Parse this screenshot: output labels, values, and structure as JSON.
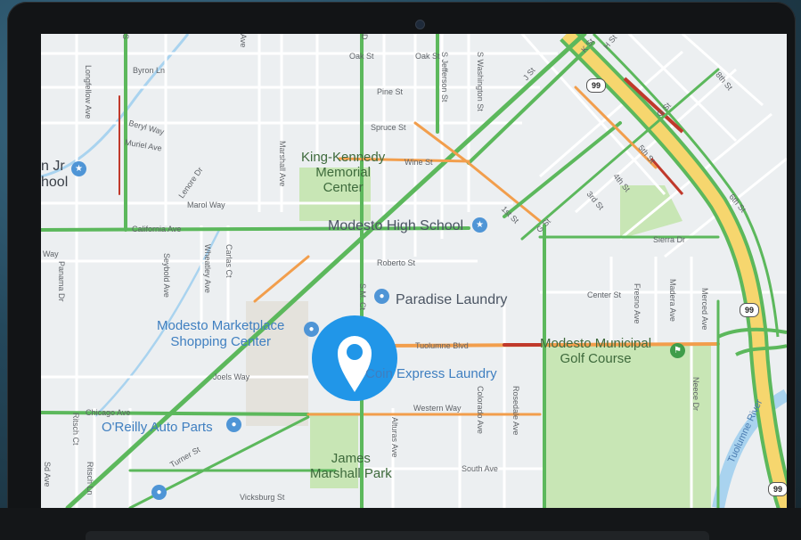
{
  "map": {
    "streets": {
      "oak_st": "Oak St",
      "oak_st2": "Oak St",
      "pine_st": "Pine St",
      "spruce_st": "Spruce St",
      "wine_st": "Wine St",
      "roberto_st": "Roberto St",
      "center_st": "Center St",
      "tuolumne_blvd": "Tuolumne Blvd",
      "western_way": "Western Way",
      "south_ave": "South Ave",
      "chicago_ave": "Chicago Ave",
      "california_ave": "California Ave",
      "byron_ln": "Byron Ln",
      "beryl_way": "Beryl Way",
      "muriel_ave": "Muriel Ave",
      "lenore_dr": "Lenore Dr",
      "marol_way": "Marol Way",
      "joels_way": "Joels Way",
      "turner_st": "Turner St",
      "vicksburg_st": "Vicksburg St",
      "sierra_dr": "Sierra Dr",
      "st_1st": "1st St",
      "g_st": "G St",
      "g_st2": "G St",
      "st_4th": "4th St",
      "st_3rd": "3rd St",
      "st_5th": "5th St",
      "st_6th": "6th St",
      "st_8th": "8th St",
      "j_st": "J St",
      "jh_st": "H St",
      "k_st": "K St",
      "longfellow_ave": "Longfellow Ave",
      "marshall_ave": "Marshall Ave",
      "jefferson_st": "S Jefferson St",
      "washington_st": "S Washington St",
      "seybold_ave": "Seybold Ave",
      "wheatley_ave": "Wheatley Ave",
      "carlas_ct": "Carlas Ct",
      "panama_dr": "Panama Dr",
      "sm_ct": "S.M. Ct",
      "alturas_ave": "Alturas Ave",
      "colorado_ave": "Colorado Ave",
      "rosedale_ave": "Rosedale Ave",
      "fresno_ave": "Fresno Ave",
      "madera_ave": "Madera Ave",
      "merced_ave": "Merced Ave",
      "neece_dr": "Neece Dr",
      "ritsch_ct": "Ritsch Ct",
      "ritsch_ln": "Ritsch Ln",
      "way": "Way",
      "ave": "Ave",
      "d_st": "D",
      "sd": "S",
      "sd_ave": "Sd Ave"
    },
    "places": {
      "king_kennedy": [
        "King-Kennedy",
        "Memorial",
        "Center"
      ],
      "modesto_high": "Modesto High School",
      "paradise_laundry": "Paradise Laundry",
      "marketplace": [
        "Modesto Marketplace",
        "Shopping Center"
      ],
      "coin_laundry": "Coin Express Laundry",
      "oreilly": "O'Reilly Auto Parts",
      "james_marshall": [
        "James",
        "Marshall Park"
      ],
      "golf": [
        "Modesto Municipal",
        "Golf Course"
      ],
      "school_cut": [
        "n Jr",
        "hool"
      ],
      "river": "Tuolumne River"
    },
    "shields": [
      "99",
      "99",
      "99"
    ],
    "colors": {
      "traffic_green": "#5cb85c",
      "traffic_orange": "#f29e4c",
      "traffic_red": "#c0392b",
      "highway_yellow": "#f6d66e",
      "park_green": "#c8e6b5",
      "water": "#a9d3ef",
      "marker": "#2196e8"
    },
    "marker_icon": "location-pin-icon"
  }
}
